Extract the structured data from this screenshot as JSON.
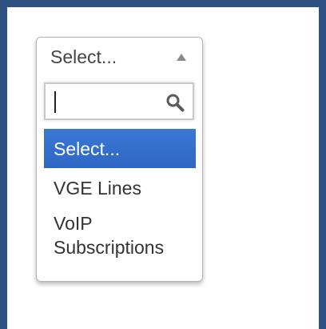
{
  "select": {
    "current_label": "Select...",
    "search": {
      "value": "",
      "placeholder": ""
    },
    "options": [
      {
        "label": "Select...",
        "selected": true
      },
      {
        "label": "VGE Lines",
        "selected": false
      },
      {
        "label": "VoIP Subscriptions",
        "selected": false
      }
    ]
  },
  "colors": {
    "frame": "#2d4f82",
    "highlight": "#3370cc"
  },
  "icons": {
    "toggle": "arrow-up-icon",
    "search": "magnifier-icon"
  }
}
